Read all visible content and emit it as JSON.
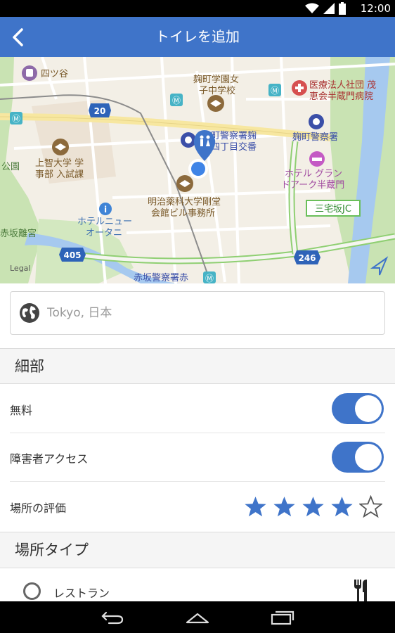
{
  "status_bar": {
    "time": "12:00",
    "icons": [
      "wifi-icon",
      "cell-signal-icon",
      "battery-icon"
    ]
  },
  "app_bar": {
    "title": "トイレを追加",
    "back_icon": "chevron-left-icon"
  },
  "map": {
    "labels": {
      "yotsuya": "四ツ谷",
      "school_1": "麹町学園女",
      "school_2": "子中学校",
      "hospital_1": "医療法人社団 茂",
      "hospital_2": "恵会半蔵門病院",
      "police_1_a": "麹町警察署麹",
      "police_1_b": "四丁目交番",
      "police_2": "麹町警察署",
      "sophia_1": "上智大学 学",
      "sophia_2": "事部 入試課",
      "koen": "公園",
      "hotel_1_a": "ホテル グラン",
      "hotel_1_b": "ドアーク半蔵門",
      "meiji_1": "明治薬科大学剛堂",
      "meiji_2": "会館ビル事務所",
      "hotel_2_a": "ホテルニュー",
      "hotel_2_b": "オータニ",
      "akasaka_palace": "赤坂離宮",
      "akasaka_police": "赤坂警察署赤",
      "legal": "Legal",
      "route_20": "20",
      "route_405": "405",
      "route_246": "246",
      "sanyazaka_jc": "三宅坂JC"
    },
    "colors": {
      "water": "#a6c9ef",
      "park": "#c9e3b3",
      "highway_edge": "#8fcf72",
      "road_yellow": "#f7e7a0",
      "accent": "#3f74c9"
    }
  },
  "location": {
    "placeholder": "Tokyo, 日本",
    "value": "",
    "icon": "globe-icon"
  },
  "details_section": {
    "header": "細部",
    "free_label": "無料",
    "free_on": true,
    "accessible_label": "障害者アクセス",
    "accessible_on": true,
    "rating_label": "場所の評価",
    "rating": 4,
    "rating_max": 5
  },
  "place_type_section": {
    "header": "場所タイプ",
    "options": [
      {
        "label": "レストラン",
        "selected": false,
        "icon": "fork-knife-icon"
      }
    ]
  },
  "nav_bar": {
    "icons": [
      "back-nav-icon",
      "home-nav-icon",
      "recents-nav-icon"
    ]
  }
}
